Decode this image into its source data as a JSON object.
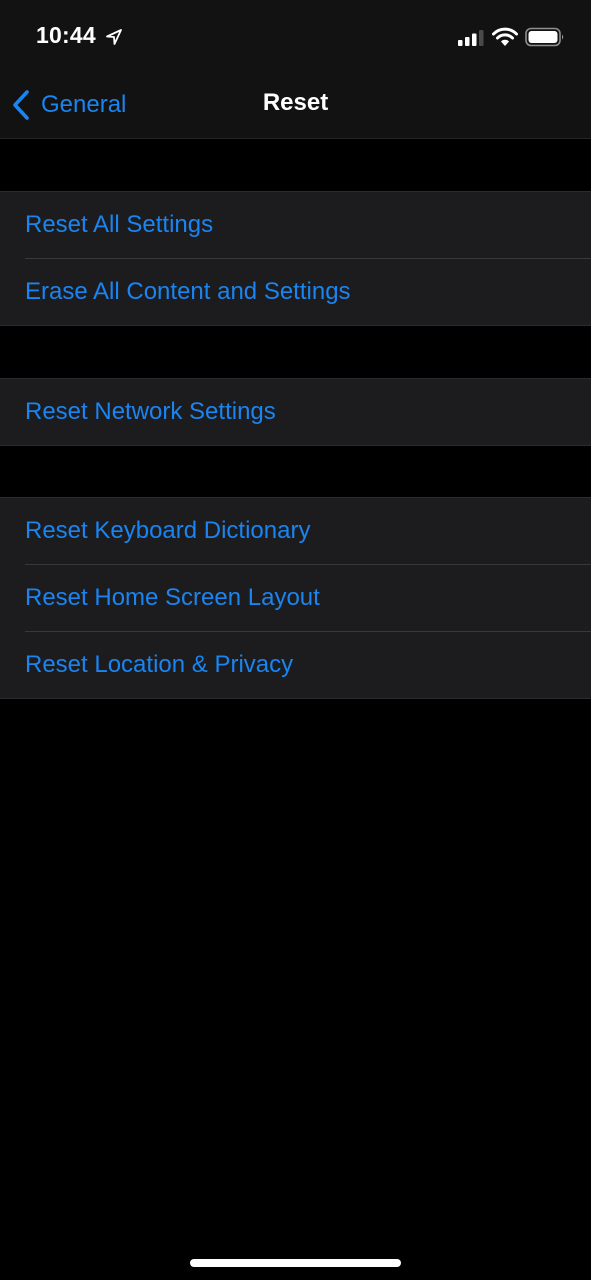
{
  "status_bar": {
    "time": "10:44",
    "location_icon": "location-arrow-icon",
    "signal_icon": "cellular-signal-icon",
    "signal_bars_active": 3,
    "signal_bars_total": 4,
    "wifi_icon": "wifi-icon",
    "battery_icon": "battery-icon",
    "battery_level": "full"
  },
  "nav": {
    "back_label": "General",
    "back_icon": "chevron-left-icon",
    "title": "Reset"
  },
  "groups": [
    {
      "items": [
        {
          "label": "Reset All Settings"
        },
        {
          "label": "Erase All Content and Settings"
        }
      ]
    },
    {
      "items": [
        {
          "label": "Reset Network Settings"
        }
      ]
    },
    {
      "items": [
        {
          "label": "Reset Keyboard Dictionary"
        },
        {
          "label": "Reset Home Screen Layout"
        },
        {
          "label": "Reset Location & Privacy"
        }
      ]
    }
  ],
  "colors": {
    "accent": "#1a84f0",
    "background": "#000000",
    "chrome": "#121212",
    "cell": "#1c1c1e"
  }
}
